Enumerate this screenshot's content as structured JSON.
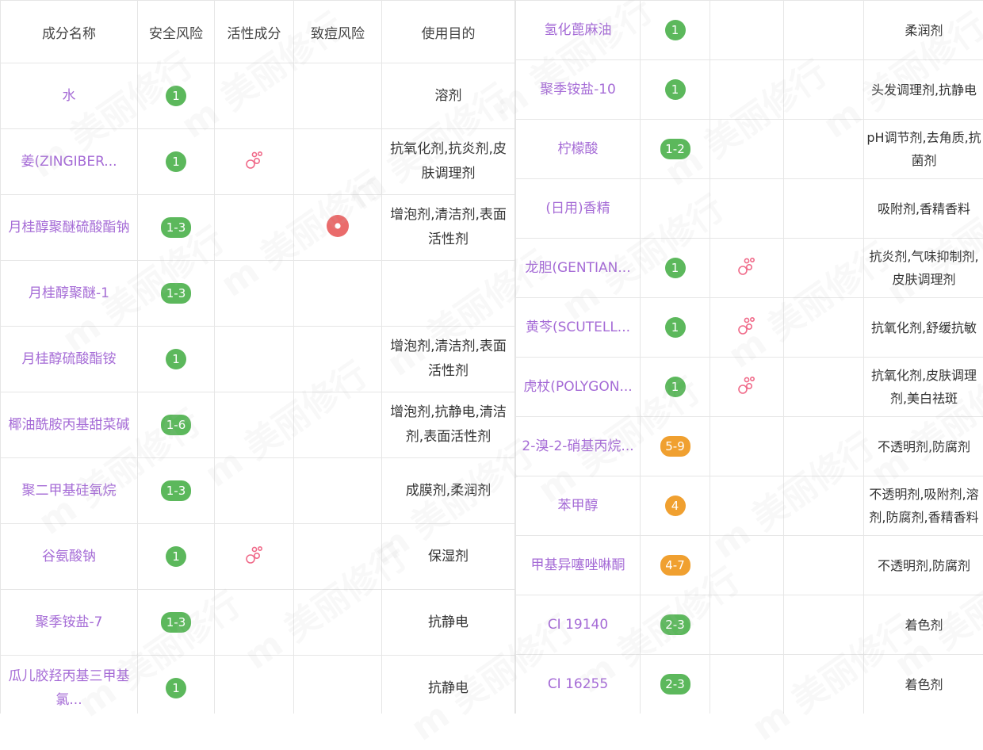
{
  "colors": {
    "green": "#5cb85c",
    "orange": "#f0a030",
    "acne": "#ea6b6b",
    "purple": "#a56bd6",
    "active": "#f06b8a"
  },
  "watermark": "m 美丽修行",
  "left": {
    "headers": [
      "成分名称",
      "安全风险",
      "活性成分",
      "致痘风险",
      "使用目的"
    ],
    "rows": [
      {
        "name": "水",
        "safety": "1",
        "safety_color": "green",
        "active": false,
        "acne": false,
        "purpose": "溶剂"
      },
      {
        "name": "姜(ZINGIBER...",
        "safety": "1",
        "safety_color": "green",
        "active": true,
        "acne": false,
        "purpose": "抗氧化剂,抗炎剂,皮肤调理剂"
      },
      {
        "name": "月桂醇聚醚硫酸酯钠",
        "safety": "1-3",
        "safety_color": "green",
        "active": false,
        "acne": true,
        "purpose": "增泡剂,清洁剂,表面活性剂"
      },
      {
        "name": "月桂醇聚醚-1",
        "safety": "1-3",
        "safety_color": "green",
        "active": false,
        "acne": false,
        "purpose": ""
      },
      {
        "name": "月桂醇硫酸酯铵",
        "safety": "1",
        "safety_color": "green",
        "active": false,
        "acne": false,
        "purpose": "增泡剂,清洁剂,表面活性剂"
      },
      {
        "name": "椰油酰胺丙基甜菜碱",
        "safety": "1-6",
        "safety_color": "green",
        "active": false,
        "acne": false,
        "purpose": "增泡剂,抗静电,清洁剂,表面活性剂"
      },
      {
        "name": "聚二甲基硅氧烷",
        "safety": "1-3",
        "safety_color": "green",
        "active": false,
        "acne": false,
        "purpose": "成膜剂,柔润剂"
      },
      {
        "name": "谷氨酸钠",
        "safety": "1",
        "safety_color": "green",
        "active": true,
        "acne": false,
        "purpose": "保湿剂"
      },
      {
        "name": "聚季铵盐-7",
        "safety": "1-3",
        "safety_color": "green",
        "active": false,
        "acne": false,
        "purpose": "抗静电"
      },
      {
        "name": "瓜儿胶羟丙基三甲基氯...",
        "safety": "1",
        "safety_color": "green",
        "active": false,
        "acne": false,
        "purpose": "抗静电"
      }
    ]
  },
  "right": {
    "rows": [
      {
        "name": "氢化蓖麻油",
        "safety": "1",
        "safety_color": "green",
        "active": false,
        "acne": false,
        "purpose": "柔润剂"
      },
      {
        "name": "聚季铵盐-10",
        "safety": "1",
        "safety_color": "green",
        "active": false,
        "acne": false,
        "purpose": "头发调理剂,抗静电"
      },
      {
        "name": "柠檬酸",
        "safety": "1-2",
        "safety_color": "green",
        "active": false,
        "acne": false,
        "purpose": "pH调节剂,去角质,抗菌剂"
      },
      {
        "name": "(日用)香精",
        "safety": "",
        "safety_color": "green",
        "active": false,
        "acne": false,
        "purpose": "吸附剂,香精香料"
      },
      {
        "name": "龙胆(GENTIAN...",
        "safety": "1",
        "safety_color": "green",
        "active": true,
        "acne": false,
        "purpose": "抗炎剂,气味抑制剂,皮肤调理剂"
      },
      {
        "name": "黄芩(SCUTELL...",
        "safety": "1",
        "safety_color": "green",
        "active": true,
        "acne": false,
        "purpose": "抗氧化剂,舒缓抗敏"
      },
      {
        "name": "虎杖(POLYGON...",
        "safety": "1",
        "safety_color": "green",
        "active": true,
        "acne": false,
        "purpose": "抗氧化剂,皮肤调理剂,美白祛斑"
      },
      {
        "name": "2-溴-2-硝基丙烷...",
        "safety": "5-9",
        "safety_color": "orange",
        "active": false,
        "acne": false,
        "purpose": "不透明剂,防腐剂"
      },
      {
        "name": "苯甲醇",
        "safety": "4",
        "safety_color": "orange",
        "active": false,
        "acne": false,
        "purpose": "不透明剂,吸附剂,溶剂,防腐剂,香精香料"
      },
      {
        "name": "甲基异噻唑啉酮",
        "safety": "4-7",
        "safety_color": "orange",
        "active": false,
        "acne": false,
        "purpose": "不透明剂,防腐剂"
      },
      {
        "name": "CI 19140",
        "safety": "2-3",
        "safety_color": "green",
        "active": false,
        "acne": false,
        "purpose": "着色剂"
      },
      {
        "name": "CI 16255",
        "safety": "2-3",
        "safety_color": "green",
        "active": false,
        "acne": false,
        "purpose": "着色剂"
      }
    ]
  }
}
